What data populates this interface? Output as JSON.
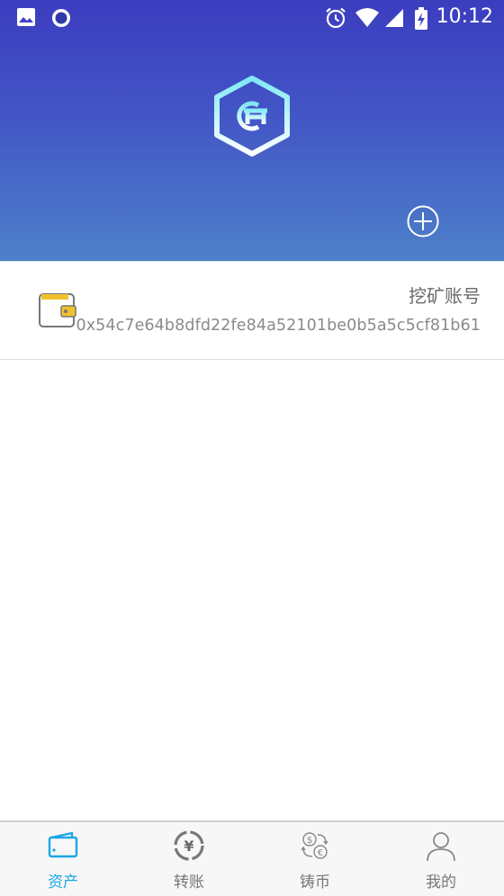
{
  "status_bar": {
    "time": "10:12",
    "icons": [
      "image-icon",
      "circle-app-icon",
      "alarm-icon",
      "wifi-icon",
      "signal-icon",
      "battery-charging-icon"
    ]
  },
  "header": {
    "logo": "hexagon-g-logo",
    "add_icon": "plus-circle-icon"
  },
  "wallets": [
    {
      "name": "挖矿账号",
      "address": "0x54c7e64b8dfd22fe84a52101be0b5a5c5cf81b61",
      "icon": "wallet-icon"
    }
  ],
  "tabs": [
    {
      "label": "资产",
      "icon": "wallet-tab-icon",
      "active": true
    },
    {
      "label": "转账",
      "icon": "yen-transfer-icon",
      "active": false
    },
    {
      "label": "铸币",
      "icon": "currency-exchange-icon",
      "active": false
    },
    {
      "label": "我的",
      "icon": "person-icon",
      "active": false
    }
  ],
  "colors": {
    "header_top": "#3b3dbf",
    "header_bottom": "#4d80c9",
    "active_tab": "#1aa7e6",
    "inactive_tab": "#777777",
    "wallet_accent": "#f2c12e"
  }
}
